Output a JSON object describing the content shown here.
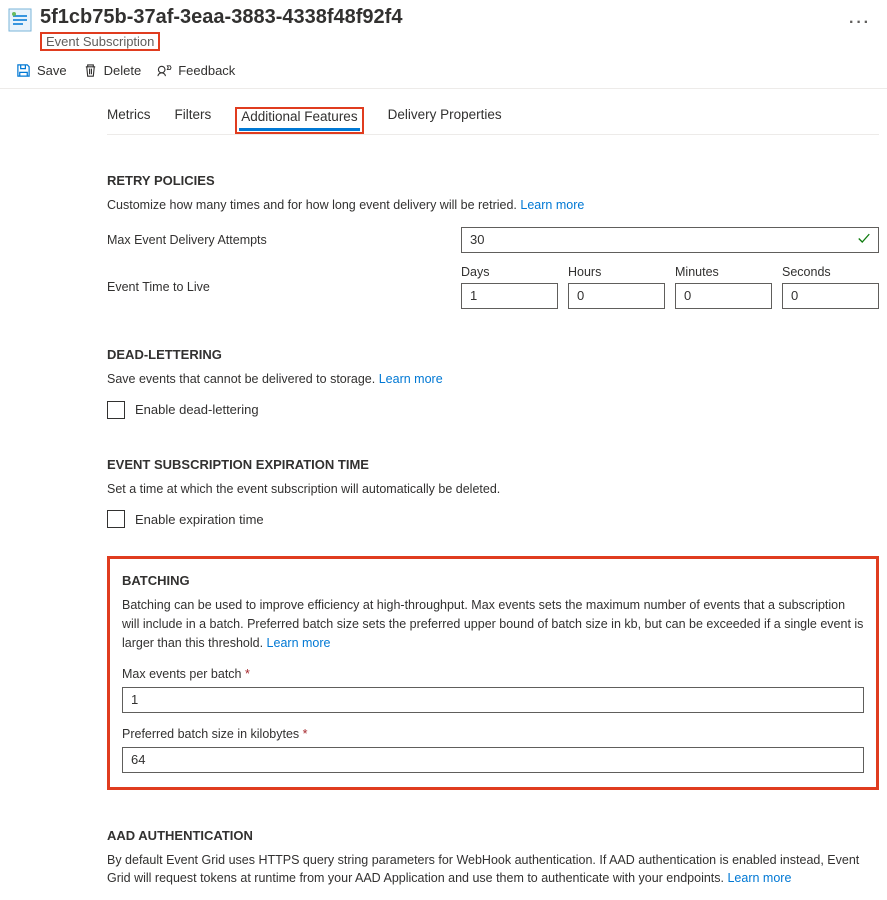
{
  "header": {
    "title": "5f1cb75b-37af-3eaa-3883-4338f48f92f4",
    "subtitle": "Event Subscription"
  },
  "toolbar": {
    "save": "Save",
    "delete": "Delete",
    "feedback": "Feedback"
  },
  "tabs": {
    "metrics": "Metrics",
    "filters": "Filters",
    "additional": "Additional Features",
    "delivery": "Delivery Properties"
  },
  "retry": {
    "title": "RETRY POLICIES",
    "desc": "Customize how many times and for how long event delivery will be retried.",
    "learn": "Learn more",
    "maxAttemptsLabel": "Max Event Delivery Attempts",
    "maxAttemptsValue": "30",
    "ttlLabel": "Event Time to Live",
    "ttl": {
      "daysLabel": "Days",
      "days": "1",
      "hoursLabel": "Hours",
      "hours": "0",
      "minutesLabel": "Minutes",
      "minutes": "0",
      "secondsLabel": "Seconds",
      "seconds": "0"
    }
  },
  "deadletter": {
    "title": "DEAD-LETTERING",
    "desc": "Save events that cannot be delivered to storage.",
    "learn": "Learn more",
    "enable": "Enable dead-lettering"
  },
  "expiration": {
    "title": "EVENT SUBSCRIPTION EXPIRATION TIME",
    "desc": "Set a time at which the event subscription will automatically be deleted.",
    "enable": "Enable expiration time"
  },
  "batching": {
    "title": "BATCHING",
    "desc": "Batching can be used to improve efficiency at high-throughput. Max events sets the maximum number of events that a subscription will include in a batch. Preferred batch size sets the preferred upper bound of batch size in kb, but can be exceeded if a single event is larger than this threshold.",
    "learn": "Learn more",
    "maxEventsLabel": "Max events per batch",
    "maxEventsValue": "1",
    "preferredSizeLabel": "Preferred batch size in kilobytes",
    "preferredSizeValue": "64"
  },
  "aad": {
    "title": "AAD AUTHENTICATION",
    "desc": "By default Event Grid uses HTTPS query string parameters for WebHook authentication. If AAD authentication is enabled instead, Event Grid will request tokens at runtime from your AAD Application and use them to authenticate with your endpoints.",
    "learn": "Learn more"
  }
}
